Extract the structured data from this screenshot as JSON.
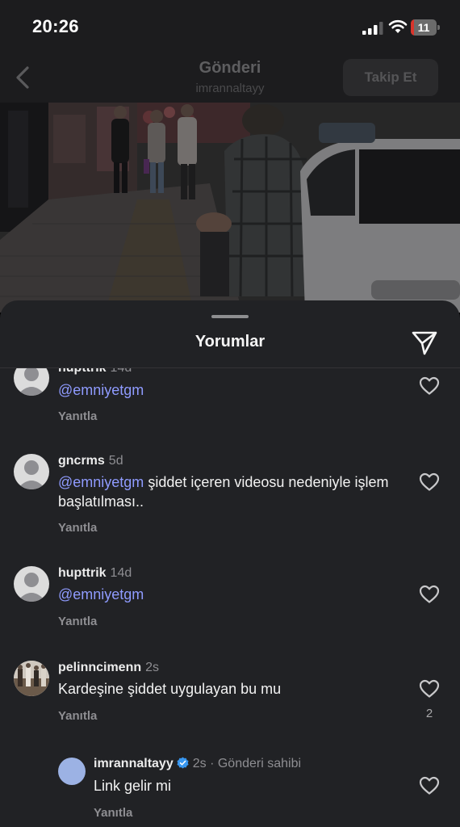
{
  "status_bar": {
    "time": "20:26",
    "battery_level": "11",
    "battery_fraction": 0.11
  },
  "header": {
    "title": "Gönderi",
    "subtitle": "imrannaltayy",
    "follow_label": "Takip Et",
    "back_icon": "chevron-left-icon"
  },
  "sheet": {
    "title": "Yorumlar",
    "share_icon": "send-icon"
  },
  "comments": [
    {
      "username": "hupttrik",
      "time": "14d",
      "text_mention": "@emniyetgm",
      "text_rest": "",
      "reply_label": "Yanıtla",
      "likes": ""
    },
    {
      "username": "gncrms",
      "time": "5d",
      "text_mention": "@emniyetgm",
      "text_rest": " şiddet içeren videosu nedeniyle işlem başlatılması..",
      "reply_label": "Yanıtla",
      "likes": ""
    },
    {
      "username": "hupttrik",
      "time": "14d",
      "text_mention": "@emniyetgm",
      "text_rest": "",
      "reply_label": "Yanıtla",
      "likes": ""
    },
    {
      "username": "pelinncimenn",
      "time": "2s",
      "text_mention": "",
      "text_rest": "Kardeşine şiddet uygulayan bu mu",
      "reply_label": "Yanıtla",
      "likes": "2"
    }
  ],
  "reply": {
    "username": "imrannaltayy",
    "verified": true,
    "time": "2s",
    "separator": " · ",
    "owner_label": "Gönderi sahibi",
    "text": "Link gelir mi",
    "reply_label": "Yanıtla"
  },
  "colors": {
    "background": "#000000",
    "sheet": "#212225",
    "mention": "#8f9bff",
    "verified": "#3897f0",
    "battery_low": "#d9342b"
  }
}
